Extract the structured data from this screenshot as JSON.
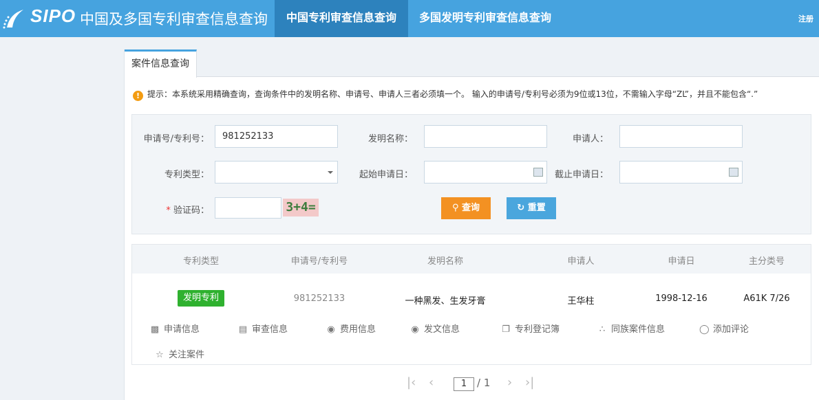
{
  "header": {
    "brand": "SIPO",
    "site_title": "中国及多国专利审查信息查询",
    "nav": [
      {
        "label": "中国专利审查信息查询",
        "active": true
      },
      {
        "label": "多国发明专利审查信息查询",
        "active": false
      }
    ],
    "register": "注册"
  },
  "tab": {
    "label": "案件信息查询"
  },
  "tip": "提示：本系统采用精确查询，查询条件中的发明名称、申请号、申请人三者必须填一个。 输入的申请号/专利号必须为9位或13位，不需输入字母“ZL”，并且不能包含“.”",
  "form": {
    "app_no_label": "申请号/专利号：",
    "app_no_value": "981252133",
    "title_label": "发明名称：",
    "title_value": "",
    "applicant_label": "申请人：",
    "applicant_value": "",
    "type_label": "专利类型：",
    "type_value": "",
    "start_date_label": "起始申请日：",
    "start_date_value": "",
    "end_date_label": "截止申请日：",
    "end_date_value": "",
    "captcha_label": "验证码：",
    "captcha_required": "*",
    "captcha_value": "",
    "captcha_text": "3+4=",
    "search_label": "查询",
    "reset_label": "重置"
  },
  "results": {
    "columns": [
      "专利类型",
      "申请号/专利号",
      "发明名称",
      "申请人",
      "申请日",
      "主分类号"
    ],
    "row": {
      "type": "发明专利",
      "app_no": "981252133",
      "title": "一种黑发、生发牙膏",
      "applicant": "王华柱",
      "date": "1998-12-16",
      "ipc": "A61K 7/26"
    },
    "actions": [
      "申请信息",
      "审查信息",
      "费用信息",
      "发文信息",
      "专利登记簿",
      "同族案件信息",
      "添加评论",
      "关注案件"
    ],
    "accent": "#2fb12f"
  },
  "pager": {
    "current": "1",
    "total": "/ 1"
  }
}
